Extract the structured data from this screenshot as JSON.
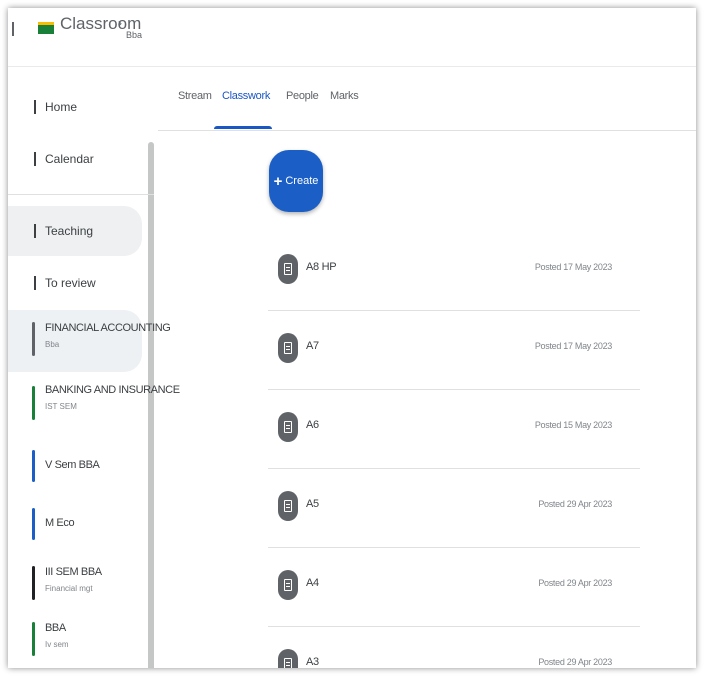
{
  "app": {
    "title": "Classroom",
    "class_sub": "Bba"
  },
  "sidebar": {
    "nav": [
      {
        "label": "Home"
      },
      {
        "label": "Calendar"
      },
      {
        "label": "Teaching"
      },
      {
        "label": "To review"
      }
    ],
    "classes": [
      {
        "name": "FINANCIAL ACCOUNTING",
        "sub": "Bba",
        "color": "#5f6368"
      },
      {
        "name": "BANKING AND INSURANCE",
        "sub": "IST SEM",
        "color": "#188038"
      },
      {
        "name": "V Sem BBA",
        "sub": "",
        "color": "#1a5ec6"
      },
      {
        "name": "M Eco",
        "sub": "",
        "color": "#1a5ec6"
      },
      {
        "name": "III SEM BBA",
        "sub": "Financial mgt",
        "color": "#202124"
      },
      {
        "name": "BBA",
        "sub": "Iv sem",
        "color": "#188038"
      }
    ]
  },
  "tabs": [
    {
      "label": "Stream"
    },
    {
      "label": "Classwork"
    },
    {
      "label": "People"
    },
    {
      "label": "Marks"
    }
  ],
  "create_label": "Create",
  "assignments": [
    {
      "title": "A8 HP",
      "date": "Posted 17 May 2023"
    },
    {
      "title": "A7",
      "date": "Posted 17 May 2023"
    },
    {
      "title": "A6",
      "date": "Posted 15 May 2023"
    },
    {
      "title": "A5",
      "date": "Posted 29 Apr 2023"
    },
    {
      "title": "A4",
      "date": "Posted 29 Apr 2023"
    },
    {
      "title": "A3",
      "date": "Posted 29 Apr 2023"
    }
  ],
  "colors": {
    "accent": "#1a5ec6",
    "brand_green": "#188038"
  }
}
